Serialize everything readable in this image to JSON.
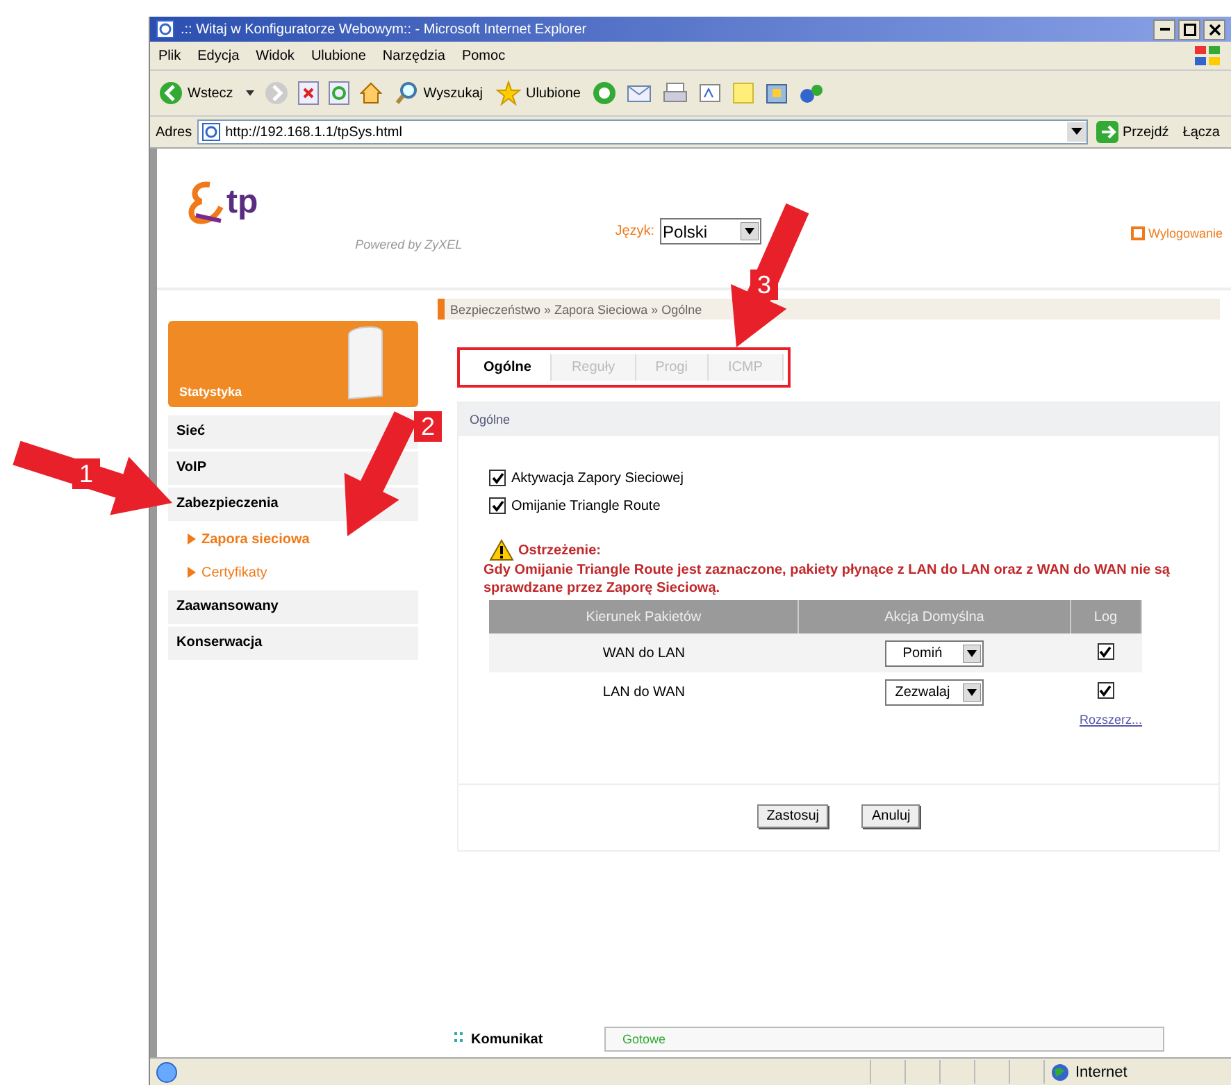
{
  "window": {
    "title": ".:: Witaj w Konfiguratorze Webowym:: - Microsoft Internet Explorer"
  },
  "menu": [
    "Plik",
    "Edycja",
    "Widok",
    "Ulubione",
    "Narzędzia",
    "Pomoc"
  ],
  "toolbar": {
    "back": "Wstecz",
    "search": "Wyszukaj",
    "favorites": "Ulubione"
  },
  "address": {
    "label": "Adres",
    "url": "http://192.168.1.1/tpSys.html",
    "go": "Przejdź",
    "links": "Łącza"
  },
  "header": {
    "logo": "tp",
    "powered_by": "Powered by ZyXEL",
    "language_label": "Język:",
    "language": "Polski",
    "logout": "Wylogowanie"
  },
  "breadcrumb": "Bezpieczeństwo » Zapora Sieciowa » Ogólne",
  "sidebar": {
    "panel_title": "Statystyka",
    "items": [
      {
        "label": "Sieć"
      },
      {
        "label": "VoIP"
      },
      {
        "label": "Zabezpieczenia",
        "children": [
          {
            "label": "Zapora sieciowa",
            "selected": true
          },
          {
            "label": "Certyfikaty",
            "selected": false
          }
        ]
      },
      {
        "label": "Zaawansowany"
      },
      {
        "label": "Konserwacja"
      }
    ]
  },
  "tabs_highlighted": true,
  "tabs": [
    {
      "label": "Ogólne",
      "selected": true
    },
    {
      "label": "Reguły",
      "selected": false
    },
    {
      "label": "Progi",
      "selected": false
    },
    {
      "label": "ICMP",
      "selected": false
    }
  ],
  "section_title": "Ogólne",
  "options": [
    {
      "label": "Aktywacja Zapory Sieciowej",
      "checked": true
    },
    {
      "label": "Omijanie Triangle Route",
      "checked": true
    }
  ],
  "warning": {
    "title": "Ostrzeżenie:",
    "text": "Gdy Omijanie Triangle Route jest zaznaczone, pakiety płynące z LAN do LAN oraz z WAN do WAN nie są sprawdzane przez Zaporę Sieciową."
  },
  "table": {
    "columns": [
      "Kierunek Pakietów",
      "Akcja Domyślna",
      "Log"
    ],
    "rows": [
      {
        "direction": "WAN do LAN",
        "action": "Pomiń",
        "log": true
      },
      {
        "direction": "LAN do WAN",
        "action": "Zezwalaj",
        "log": true
      }
    ]
  },
  "more_link": "Rozszerz...",
  "buttons": [
    "Zastosuj",
    "Anuluj"
  ],
  "message": {
    "label": "Komunikat",
    "value": "Gotowe"
  },
  "status_bar": {
    "zone": "Internet"
  },
  "annotations": [
    {
      "number": "1"
    },
    {
      "number": "2"
    },
    {
      "number": "3"
    }
  ]
}
